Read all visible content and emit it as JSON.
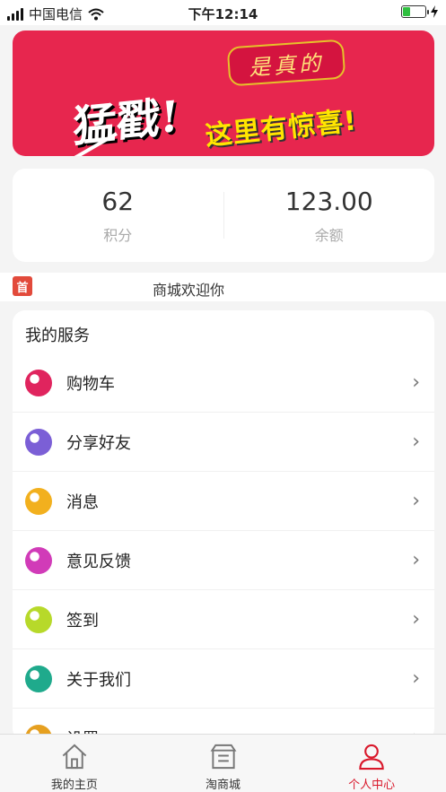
{
  "status_bar": {
    "carrier": "中国电信",
    "time": "下午12:14",
    "battery_level": 0.35
  },
  "banner": {
    "bubble_text": "是真的",
    "main_text": "猛戳!",
    "sub_text": "这里有惊喜!"
  },
  "stats": [
    {
      "value": "62",
      "label": "积分"
    },
    {
      "value": "123.00",
      "label": "余额"
    }
  ],
  "notice": {
    "icon_text": "首",
    "text": "商城欢迎你"
  },
  "services": {
    "title": "我的服务",
    "items": [
      {
        "label": "购物车",
        "icon": "candy-red-icon",
        "color": "#e0245e"
      },
      {
        "label": "分享好友",
        "icon": "candy-striped-icon",
        "color": "#7b5fd6"
      },
      {
        "label": "消息",
        "icon": "candy-wrapped-icon",
        "color": "#f2b01e"
      },
      {
        "label": "意见反馈",
        "icon": "candy-pink-icon",
        "color": "#d13bb8"
      },
      {
        "label": "签到",
        "icon": "star-icon",
        "color": "#b7d92a"
      },
      {
        "label": "关于我们",
        "icon": "candy-swirl-icon",
        "color": "#1faa8c"
      },
      {
        "label": "设置",
        "icon": "gear-icon",
        "color": "#e6a020"
      }
    ],
    "arrow": "›"
  },
  "tabbar": {
    "tabs": [
      {
        "label": "我的主页",
        "icon": "home-icon",
        "active": false
      },
      {
        "label": "淘商城",
        "icon": "store-icon",
        "active": false
      },
      {
        "label": "个人中心",
        "icon": "user-icon",
        "active": true
      }
    ],
    "active_color": "#d9182b"
  }
}
